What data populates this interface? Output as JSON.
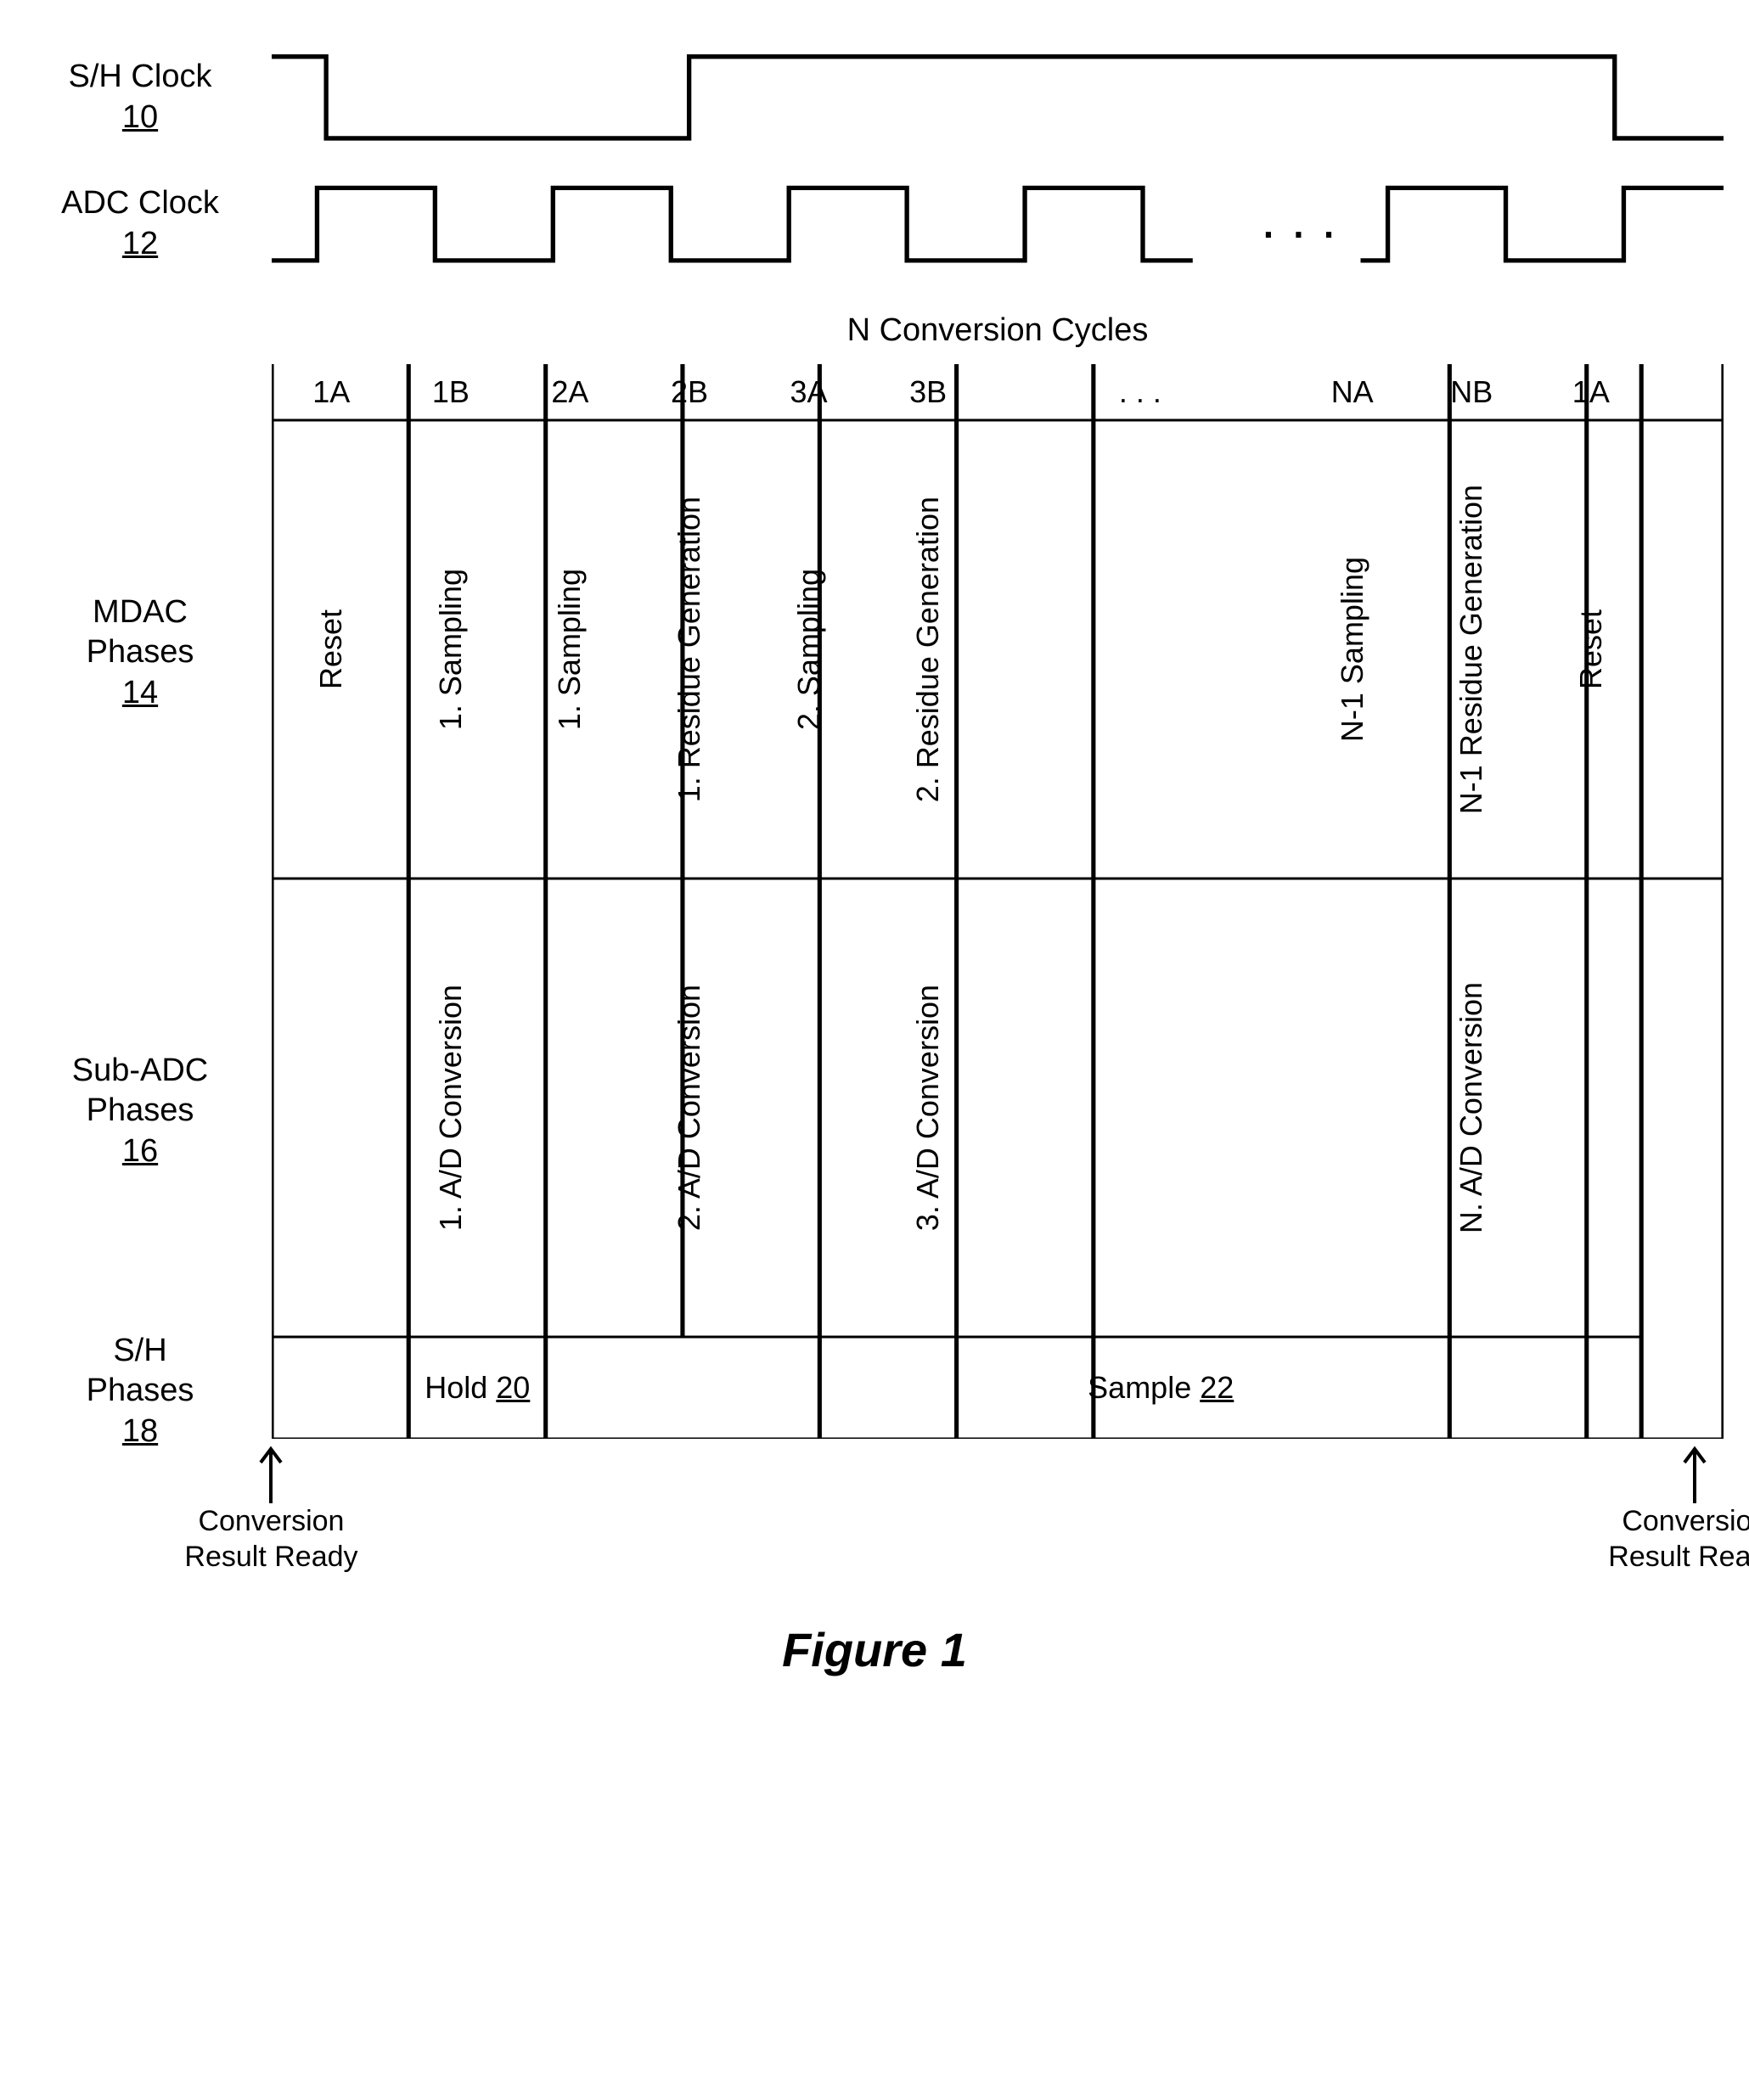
{
  "labels": {
    "sh_clock": "S/H Clock",
    "sh_clock_ref": "10",
    "adc_clock": "ADC Clock",
    "adc_clock_ref": "12",
    "cycles_title": "N Conversion Cycles",
    "mdac": "MDAC\nPhases",
    "mdac_ref": "14",
    "subadc": "Sub-ADC\nPhases",
    "subadc_ref": "16",
    "sh_phases": "S/H\nPhases",
    "sh_phases_ref": "18"
  },
  "headers": [
    "1A",
    "1B",
    "2A",
    "2B",
    "3A",
    "3B",
    ". . .",
    "NA",
    "NB",
    "1A"
  ],
  "mdac": {
    "c1A": "Reset",
    "c1B": "1. Sampling",
    "c2A": "1. Sampling",
    "c2B": "1. Residue Generation",
    "c3A": "2. Sampling",
    "c3B": "2. Residue Generation",
    "cNA": "N-1 Sampling",
    "cNB": "N-1 Residue Generation",
    "c1A2": "Reset"
  },
  "subadc": {
    "c1B": "1. A/D Conversion",
    "c2B": "2. A/D Conversion",
    "c3B": "3. A/D Conversion",
    "cNB": "N. A/D Conversion"
  },
  "sh": {
    "hold": "Hold",
    "hold_ref": "20",
    "sample": "Sample",
    "sample_ref": "22"
  },
  "annotations": {
    "left": "Conversion\nResult Ready",
    "right": "Conversion\nResult Ready"
  },
  "figure": "Figure 1"
}
